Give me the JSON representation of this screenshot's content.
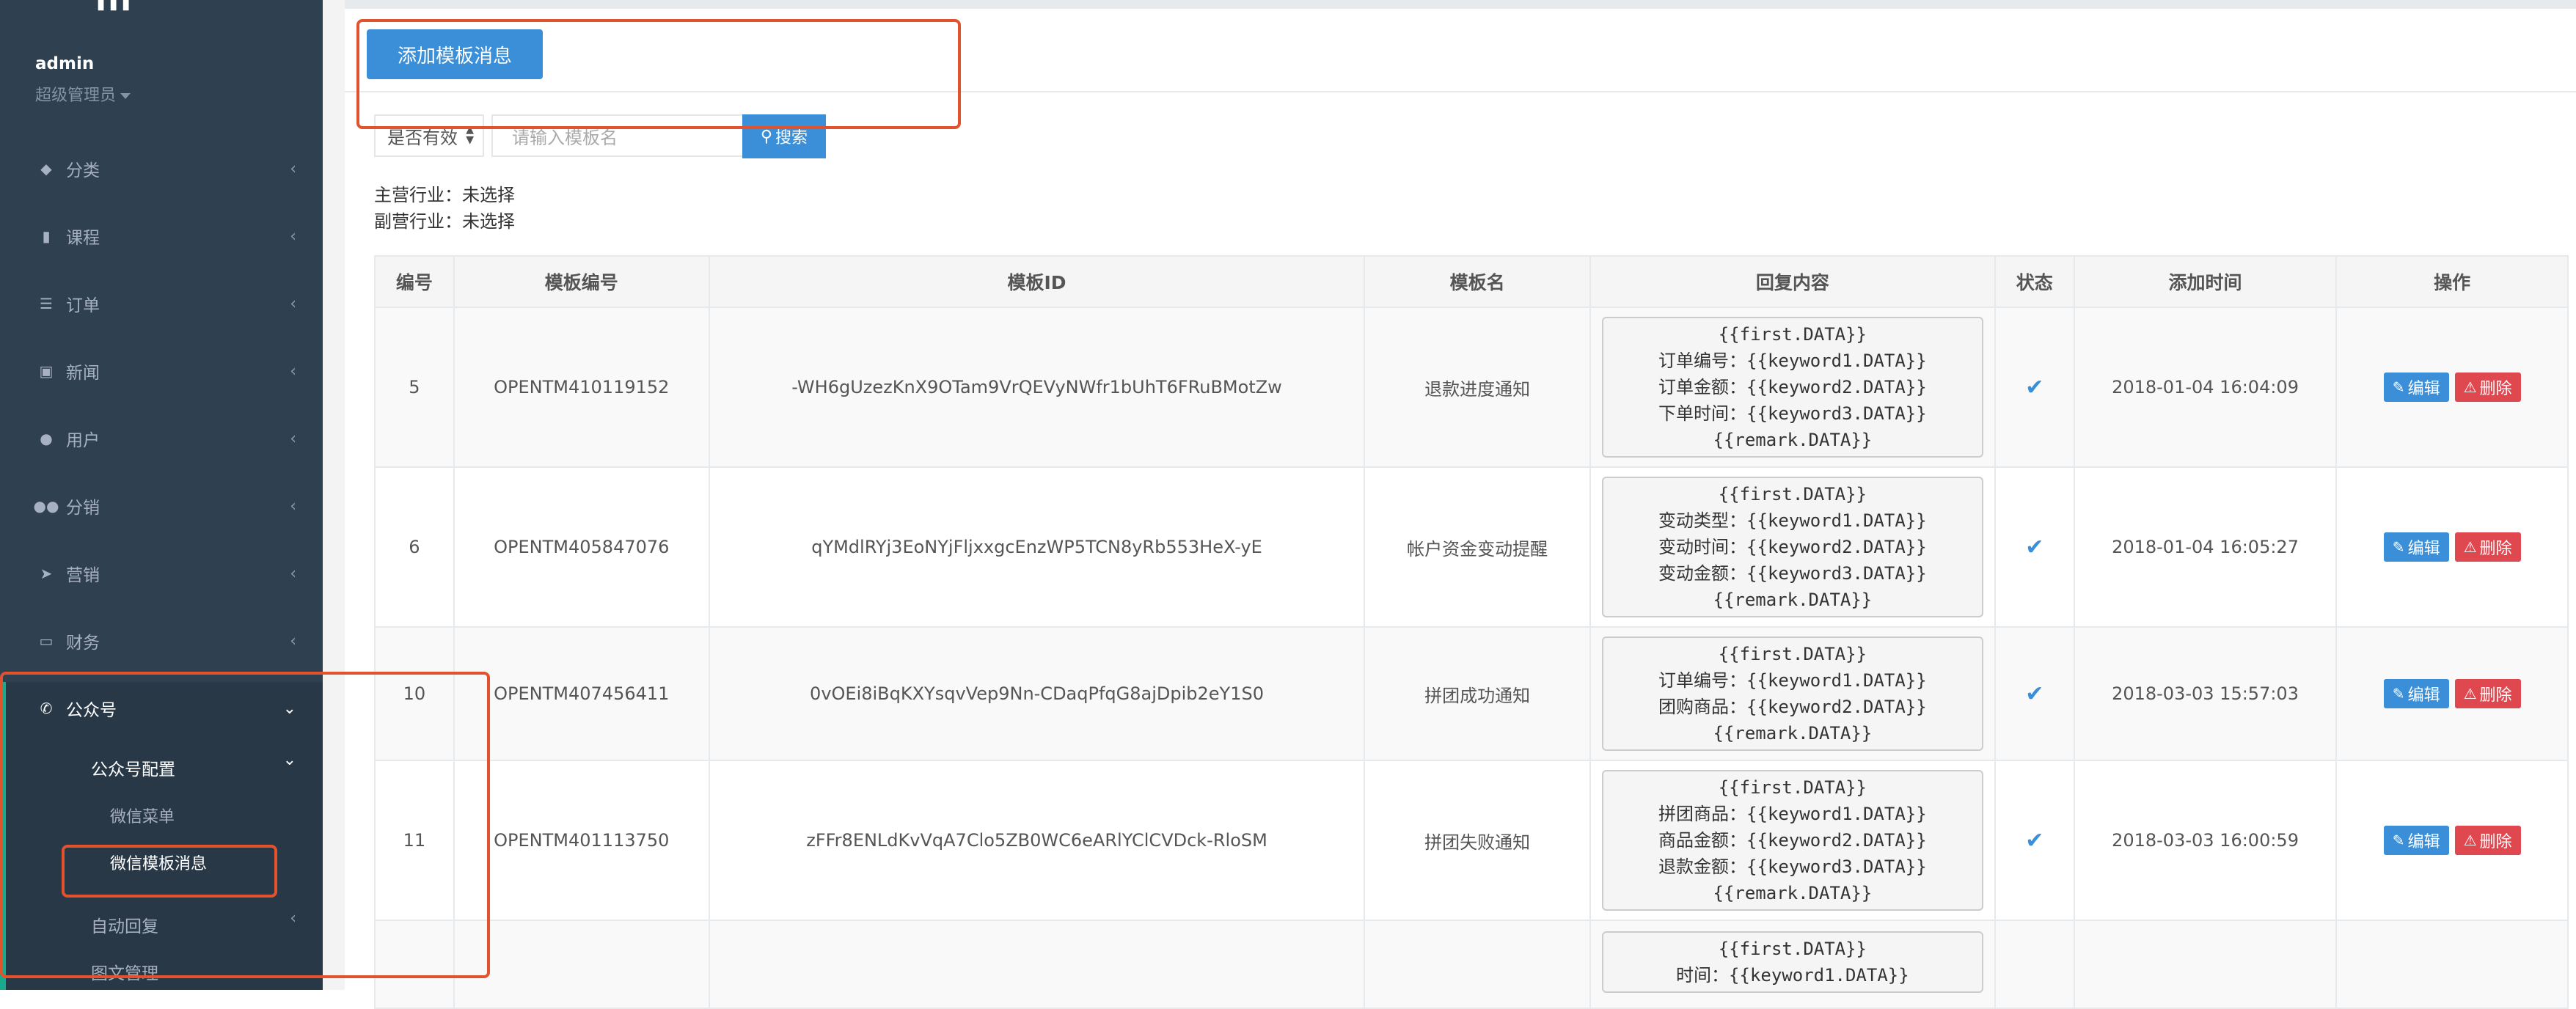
{
  "sidebar": {
    "logo_fragment": "lll",
    "profile": {
      "name": "admin",
      "role": "超级管理员"
    },
    "items": [
      {
        "label": "分类",
        "icon": "tag-icon"
      },
      {
        "label": "课程",
        "icon": "book-icon"
      },
      {
        "label": "订单",
        "icon": "list-icon"
      },
      {
        "label": "新闻",
        "icon": "image-icon"
      },
      {
        "label": "用户",
        "icon": "user-icon"
      },
      {
        "label": "分销",
        "icon": "users-icon"
      },
      {
        "label": "营销",
        "icon": "send-icon"
      },
      {
        "label": "财务",
        "icon": "money-icon"
      },
      {
        "label": "公众号",
        "icon": "wechat-icon"
      }
    ],
    "submenu": {
      "config": "公众号配置",
      "wechat_menu": "微信菜单",
      "wechat_template": "微信模板消息",
      "auto_reply": "自动回复",
      "media": "图文管理"
    }
  },
  "toolbar": {
    "add_button": "添加模板消息",
    "filter_select": "是否有效",
    "search_placeholder": "请输入模板名",
    "search_button": "搜索"
  },
  "industry": {
    "primary": "主营行业：未选择",
    "secondary": "副营行业：未选择"
  },
  "table": {
    "headers": [
      "编号",
      "模板编号",
      "模板ID",
      "模板名",
      "回复内容",
      "状态",
      "添加时间",
      "操作"
    ],
    "edit_label": "编辑",
    "delete_label": "删除",
    "rows": [
      {
        "id": "5",
        "code": "OPENTM410119152",
        "tid": "-WH6gUzezKnX9OTam9VrQEVyNWfr1bUhT6FRuBMotZw",
        "name": "退款进度通知",
        "content": [
          "{{first.DATA}}",
          "订单编号：{{keyword1.DATA}}",
          "订单金额：{{keyword2.DATA}}",
          "下单时间：{{keyword3.DATA}}",
          "{{remark.DATA}}"
        ],
        "time": "2018-01-04 16:04:09"
      },
      {
        "id": "6",
        "code": "OPENTM405847076",
        "tid": "qYMdlRYj3EoNYjFljxxgcEnzWP5TCN8yRb553HeX-yE",
        "name": "帐户资金变动提醒",
        "content": [
          "{{first.DATA}}",
          "变动类型：{{keyword1.DATA}}",
          "变动时间：{{keyword2.DATA}}",
          "变动金额：{{keyword3.DATA}}",
          "{{remark.DATA}}"
        ],
        "time": "2018-01-04 16:05:27"
      },
      {
        "id": "10",
        "code": "OPENTM407456411",
        "tid": "0vOEi8iBqKXYsqvVep9Nn-CDaqPfqG8ajDpib2eY1S0",
        "name": "拼团成功通知",
        "content": [
          "{{first.DATA}}",
          "订单编号：{{keyword1.DATA}}",
          "团购商品：{{keyword2.DATA}}",
          "{{remark.DATA}}"
        ],
        "time": "2018-03-03 15:57:03"
      },
      {
        "id": "11",
        "code": "OPENTM401113750",
        "tid": "zFFr8ENLdKvVqA7Clo5ZB0WC6eARlYClCVDck-RloSM",
        "name": "拼团失败通知",
        "content": [
          "{{first.DATA}}",
          "拼团商品：{{keyword1.DATA}}",
          "商品金额：{{keyword2.DATA}}",
          "退款金额：{{keyword3.DATA}}",
          "{{remark.DATA}}"
        ],
        "time": "2018-03-03 16:00:59"
      },
      {
        "id": "",
        "code": "",
        "tid": "",
        "name": "",
        "content": [
          "{{first.DATA}}",
          "时间：{{keyword1.DATA}}"
        ],
        "time": ""
      }
    ]
  },
  "colors": {
    "sidebar_bg": "#2f4050",
    "primary_button": "#3b8fd8",
    "danger_button": "#e0484f",
    "annotation_red": "#e2522c",
    "active_bar": "#19aa8d"
  }
}
